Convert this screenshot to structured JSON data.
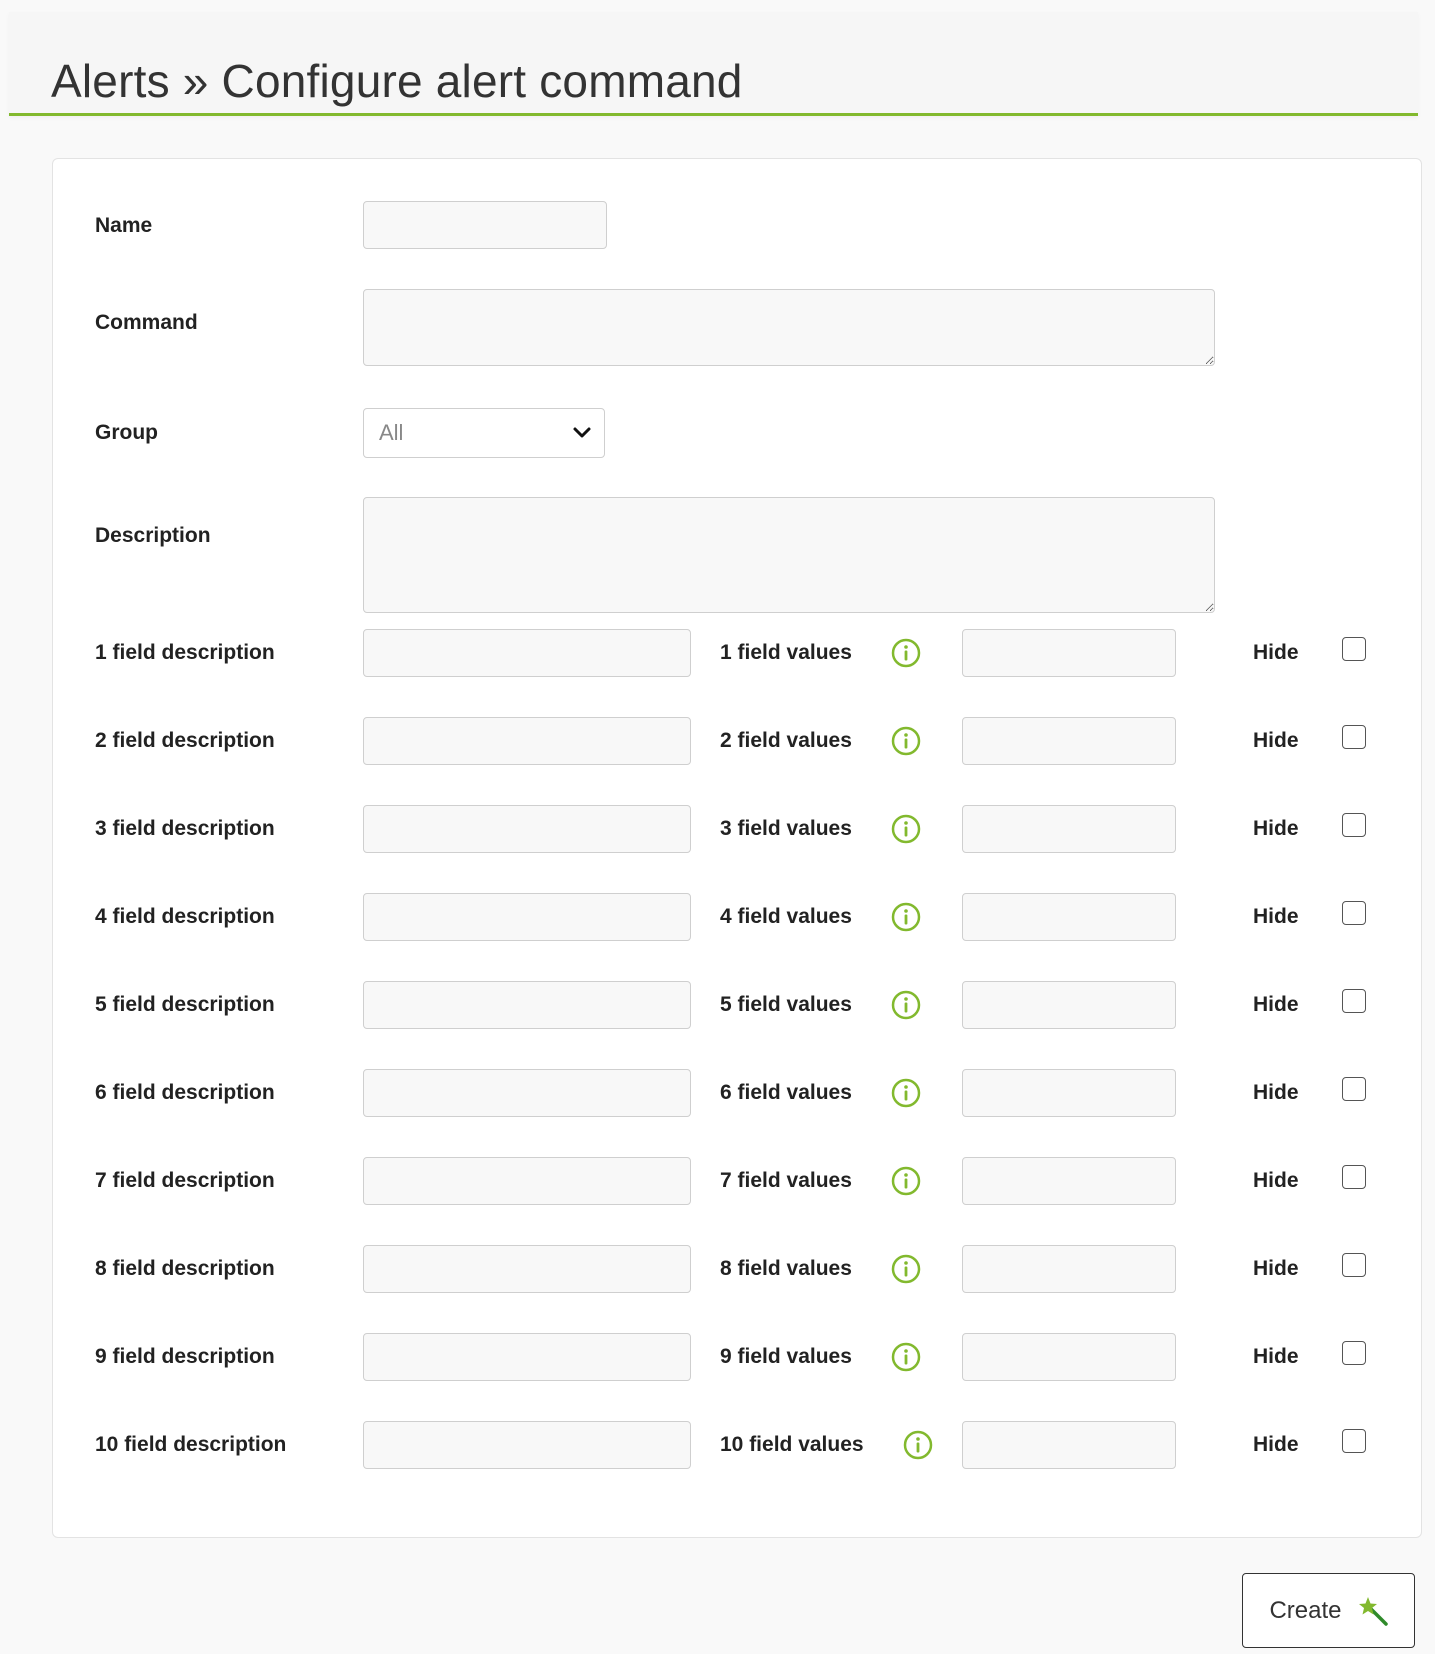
{
  "header": {
    "title": "Alerts » Configure alert command"
  },
  "form": {
    "name": {
      "label": "Name",
      "value": ""
    },
    "command": {
      "label": "Command",
      "value": ""
    },
    "group": {
      "label": "Group",
      "selected": "All"
    },
    "description": {
      "label": "Description",
      "value": ""
    },
    "fields": [
      {
        "description_label": "1 field description",
        "values_label": "1 field values",
        "hide_label": "Hide",
        "hidden": false
      },
      {
        "description_label": "2 field description",
        "values_label": "2 field values",
        "hide_label": "Hide",
        "hidden": false
      },
      {
        "description_label": "3 field description",
        "values_label": "3 field values",
        "hide_label": "Hide",
        "hidden": false
      },
      {
        "description_label": "4 field description",
        "values_label": "4 field values",
        "hide_label": "Hide",
        "hidden": false
      },
      {
        "description_label": "5 field description",
        "values_label": "5 field values",
        "hide_label": "Hide",
        "hidden": false
      },
      {
        "description_label": "6 field description",
        "values_label": "6 field values",
        "hide_label": "Hide",
        "hidden": false
      },
      {
        "description_label": "7 field description",
        "values_label": "7 field values",
        "hide_label": "Hide",
        "hidden": false
      },
      {
        "description_label": "8 field description",
        "values_label": "8 field values",
        "hide_label": "Hide",
        "hidden": false
      },
      {
        "description_label": "9 field description",
        "values_label": "9 field values",
        "hide_label": "Hide",
        "hidden": false
      },
      {
        "description_label": "10 field description",
        "values_label": "10 field values",
        "hide_label": "Hide",
        "hidden": false
      }
    ]
  },
  "actions": {
    "create_label": "Create"
  },
  "icons": {
    "info": "info-circle-icon",
    "chevron": "chevron-down-icon",
    "create": "magic-wand-icon"
  },
  "colors": {
    "accent": "#82b92e",
    "panel_bg": "#ffffff",
    "page_bg": "#f9f9f9"
  }
}
